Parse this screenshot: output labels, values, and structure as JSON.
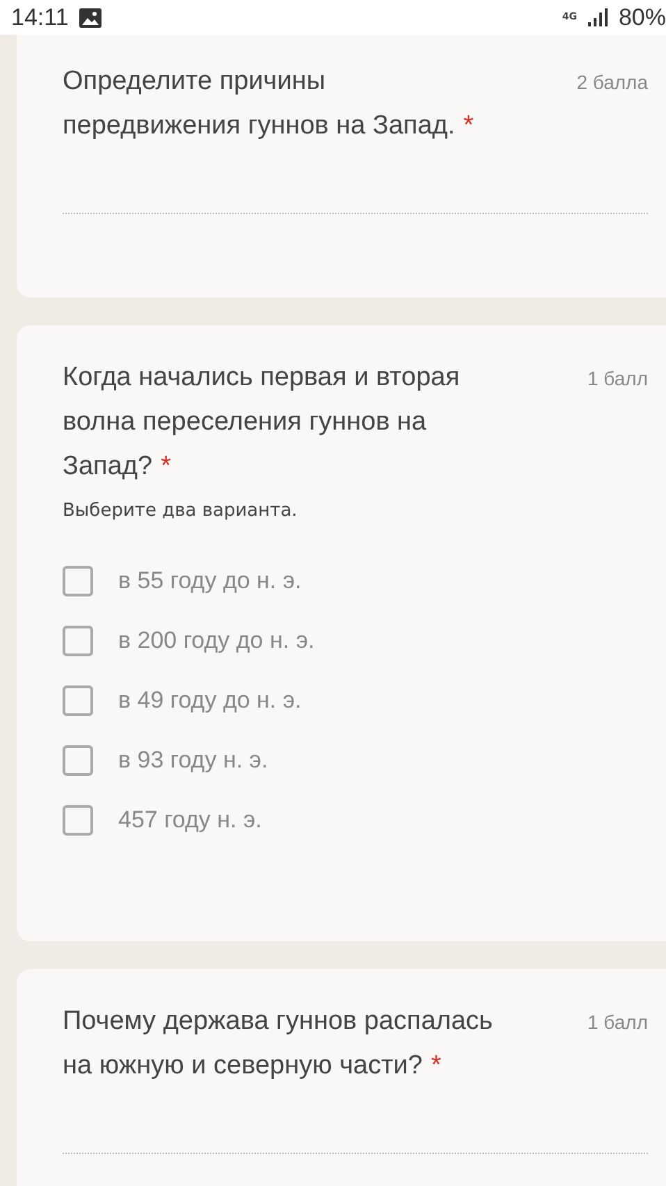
{
  "status_bar": {
    "time": "14:11",
    "network": "4G",
    "battery": "80%"
  },
  "questions": [
    {
      "kind": "text",
      "title": "Определите причины передвижения гуннов на Запад.",
      "required_mark": "*",
      "points": "2 балла",
      "top_cut": true
    },
    {
      "kind": "checkbox",
      "title": "Когда начались первая и вторая волна переселения гуннов на Запад?",
      "required_mark": "*",
      "points": "1 балл",
      "hint": "Выберите два варианта.",
      "options": [
        {
          "label": "в 55 году до н. э.",
          "checked": false
        },
        {
          "label": "в 200 году до н. э.",
          "checked": false
        },
        {
          "label": "в 49 году до н. э.",
          "checked": false
        },
        {
          "label": "в 93 году н. э.",
          "checked": false
        },
        {
          "label": "457 году н. э.",
          "checked": false
        }
      ]
    },
    {
      "kind": "text",
      "title": "Почему держава гуннов распалась на южную и северную части?",
      "required_mark": "*",
      "points": "1 балл",
      "top_cut": false
    }
  ]
}
